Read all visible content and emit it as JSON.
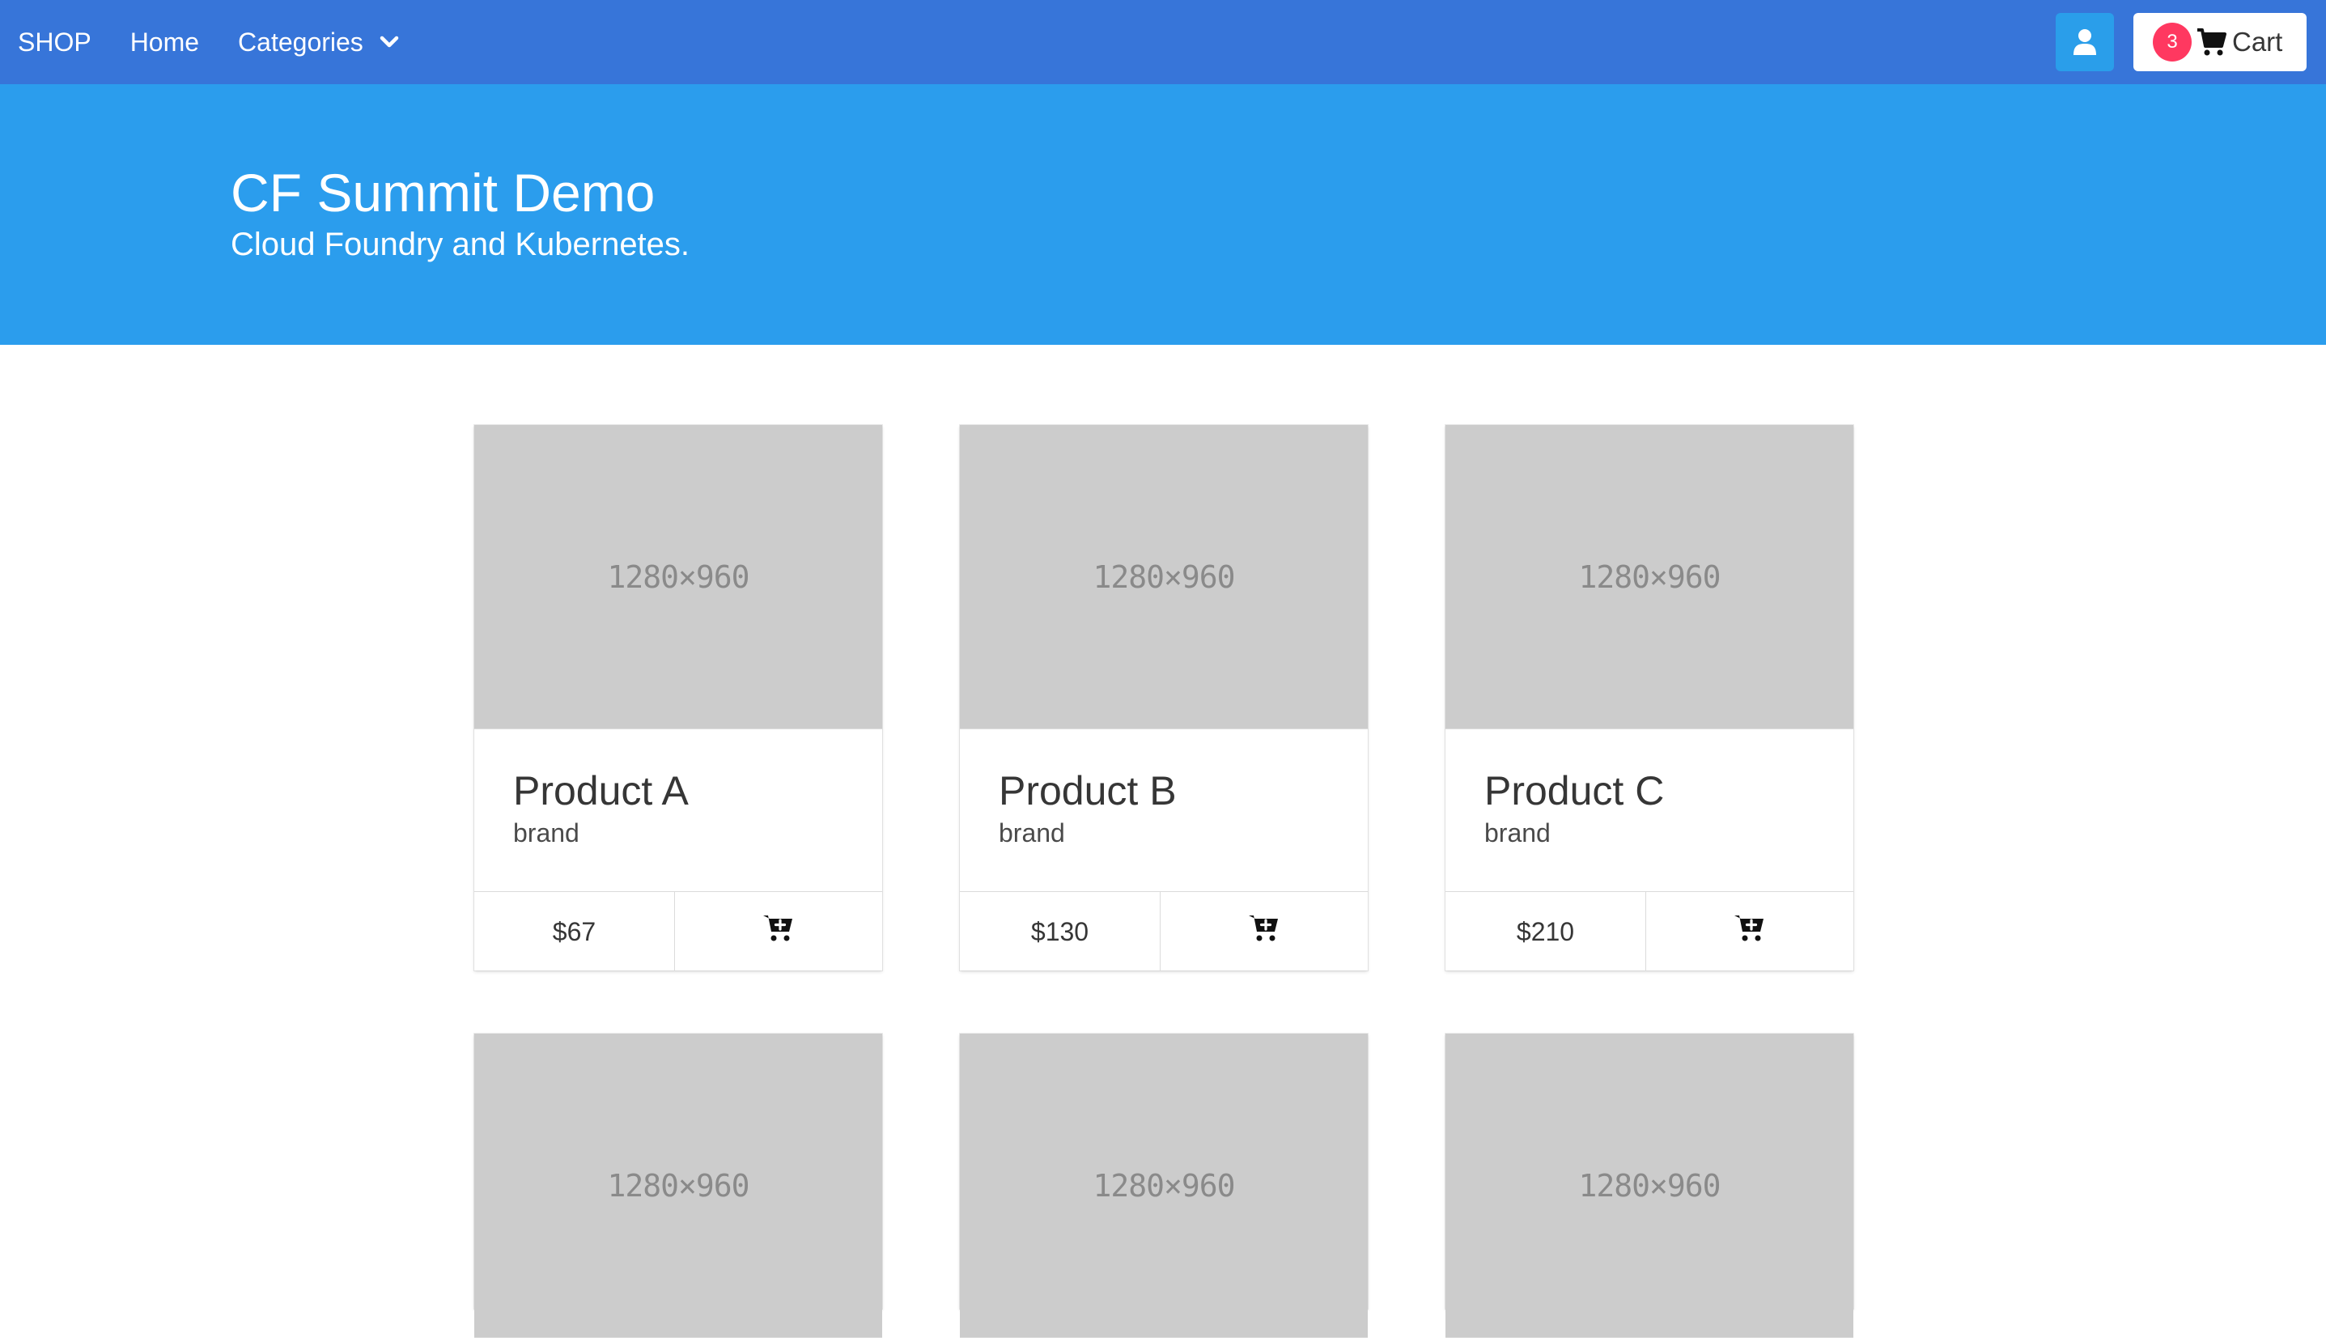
{
  "navbar": {
    "brand": "SHOP",
    "home": "Home",
    "categories": "Categories",
    "cart_count": "3",
    "cart_label": "Cart",
    "icons": {
      "user": "user-icon",
      "cart": "cart-icon",
      "chevron": "chevron-down-icon"
    },
    "colors": {
      "navbar_bg": "#3775d9",
      "user_button_bg": "#2a9eea",
      "badge_bg": "#ff3860"
    }
  },
  "hero": {
    "title": "CF Summit Demo",
    "subtitle": "Cloud Foundry and Kubernetes.",
    "bg_color": "#2b9ded"
  },
  "products": [
    {
      "image_label": "1280×960",
      "name": "Product A",
      "brand": "brand",
      "price": "$67"
    },
    {
      "image_label": "1280×960",
      "name": "Product B",
      "brand": "brand",
      "price": "$130"
    },
    {
      "image_label": "1280×960",
      "name": "Product C",
      "brand": "brand",
      "price": "$210"
    }
  ],
  "products_row2": [
    {
      "image_label": "1280×960"
    },
    {
      "image_label": "1280×960"
    },
    {
      "image_label": "1280×960"
    }
  ]
}
